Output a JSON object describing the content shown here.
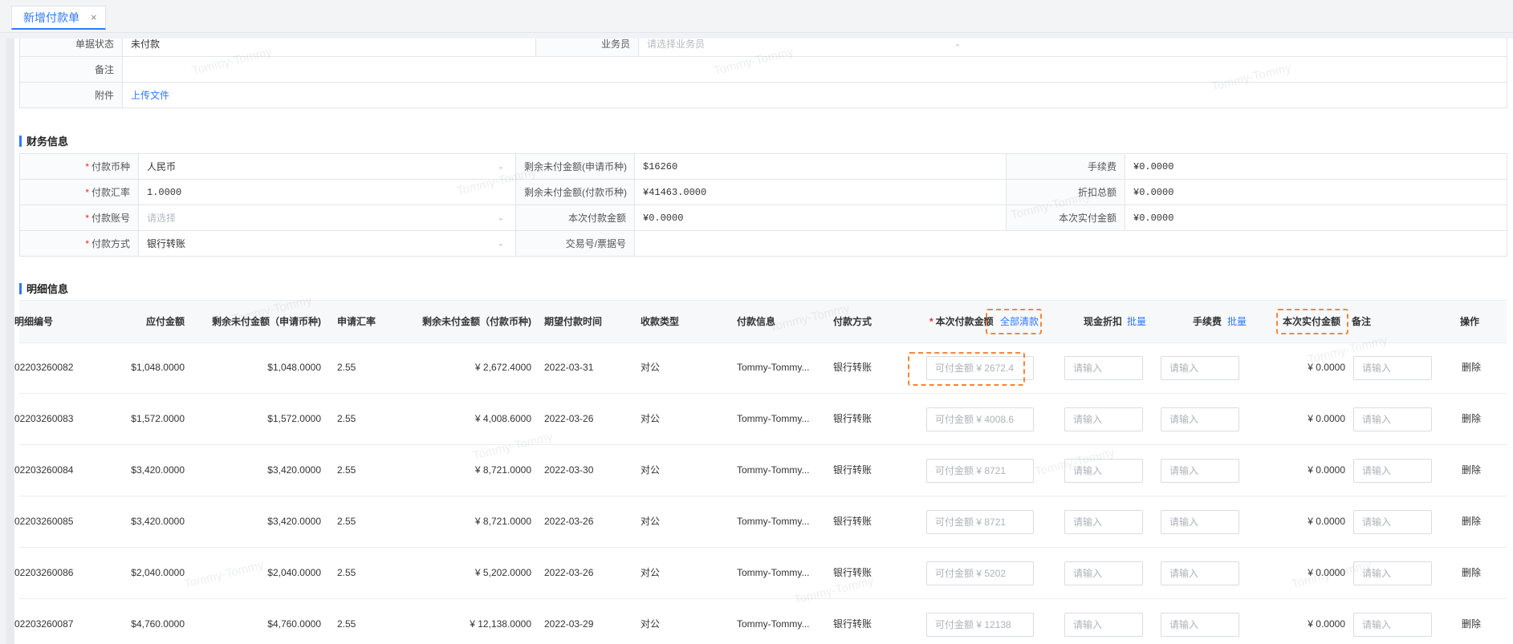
{
  "tab": {
    "title": "新增付款单",
    "close": "×"
  },
  "basic": {
    "status_label": "单据状态",
    "status_value": "未付款",
    "salesman_label": "业务员",
    "salesman_placeholder": "请选择业务员",
    "remark_label": "备注",
    "attachment_label": "附件",
    "upload_link": "上传文件"
  },
  "finance": {
    "title": "财务信息",
    "currency_label": "付款币种",
    "currency_value": "人民币",
    "rate_label": "付款汇率",
    "rate_value": "1.0000",
    "account_label": "付款账号",
    "account_placeholder": "请选择",
    "method_label": "付款方式",
    "method_value": "银行转账",
    "remain_apply_label": "剩余未付金额(申请币种)",
    "remain_apply_value": "$16260",
    "remain_pay_label": "剩余未付金额(付款币种)",
    "remain_pay_value": "¥41463.0000",
    "this_amount_label": "本次付款金额",
    "this_amount_value": "¥0.0000",
    "trade_no_label": "交易号/票据号",
    "fee_label": "手续费",
    "fee_value": "¥0.0000",
    "discount_label": "折扣总额",
    "discount_value": "¥0.0000",
    "actual_label": "本次实付金额",
    "actual_value": "¥0.0000"
  },
  "detail": {
    "title": "明细信息",
    "headers": {
      "no": "明细编号",
      "payable": "应付金额",
      "remain_apply": "剩余未付金额（申请币种)",
      "rate": "申请汇率",
      "remain_pay": "剩余未付金额（付款币种)",
      "due": "期望付款时间",
      "type": "收款类型",
      "payee": "付款信息",
      "method": "付款方式",
      "this_amount": "本次付款金额",
      "pay_all": "全部清款",
      "discount": "现金折扣",
      "discount_batch": "批量",
      "fee": "手续费",
      "fee_batch": "批量",
      "actual": "本次实付金额",
      "remark": "备注",
      "op": "操作"
    },
    "input_placeholder": "请输入",
    "delete_label": "删除",
    "rows": [
      {
        "no": "02203260082",
        "payable": "$1,048.0000",
        "remain_apply": "$1,048.0000",
        "rate": "2.55",
        "remain_pay": "¥ 2,672.4000",
        "due": "2022-03-31",
        "type": "对公",
        "payee": "Tommy-Tommy...",
        "method": "银行转账",
        "avail": "可付金额 ¥ 2672.4",
        "actual": "¥ 0.0000"
      },
      {
        "no": "02203260083",
        "payable": "$1,572.0000",
        "remain_apply": "$1,572.0000",
        "rate": "2.55",
        "remain_pay": "¥ 4,008.6000",
        "due": "2022-03-26",
        "type": "对公",
        "payee": "Tommy-Tommy...",
        "method": "银行转账",
        "avail": "可付金额 ¥ 4008.6",
        "actual": "¥ 0.0000"
      },
      {
        "no": "02203260084",
        "payable": "$3,420.0000",
        "remain_apply": "$3,420.0000",
        "rate": "2.55",
        "remain_pay": "¥ 8,721.0000",
        "due": "2022-03-30",
        "type": "对公",
        "payee": "Tommy-Tommy...",
        "method": "银行转账",
        "avail": "可付金额 ¥ 8721",
        "actual": "¥ 0.0000"
      },
      {
        "no": "02203260085",
        "payable": "$3,420.0000",
        "remain_apply": "$3,420.0000",
        "rate": "2.55",
        "remain_pay": "¥ 8,721.0000",
        "due": "2022-03-26",
        "type": "对公",
        "payee": "Tommy-Tommy...",
        "method": "银行转账",
        "avail": "可付金额 ¥ 8721",
        "actual": "¥ 0.0000"
      },
      {
        "no": "02203260086",
        "payable": "$2,040.0000",
        "remain_apply": "$2,040.0000",
        "rate": "2.55",
        "remain_pay": "¥ 5,202.0000",
        "due": "2022-03-26",
        "type": "对公",
        "payee": "Tommy-Tommy...",
        "method": "银行转账",
        "avail": "可付金额 ¥ 5202",
        "actual": "¥ 0.0000"
      },
      {
        "no": "02203260087",
        "payable": "$4,760.0000",
        "remain_apply": "$4,760.0000",
        "rate": "2.55",
        "remain_pay": "¥ 12,138.0000",
        "due": "2022-03-29",
        "type": "对公",
        "payee": "Tommy-Tommy...",
        "method": "银行转账",
        "avail": "可付金额 ¥ 12138",
        "actual": "¥ 0.0000"
      }
    ]
  }
}
